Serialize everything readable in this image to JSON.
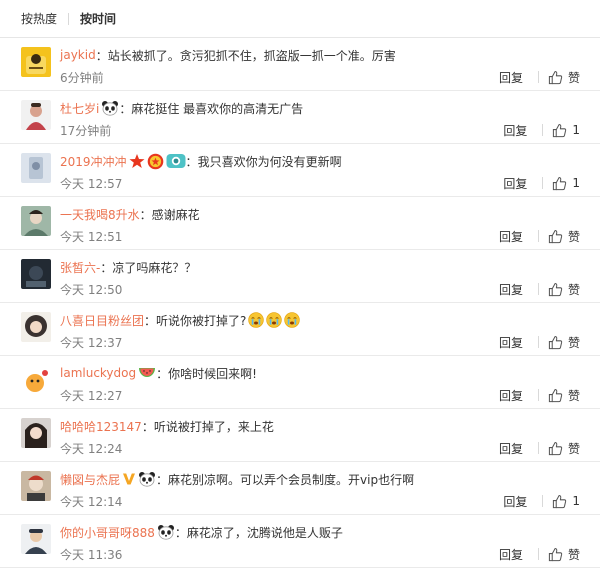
{
  "sort": {
    "hot": "按热度",
    "time": "按时间"
  },
  "reply_label": "回复",
  "colors": {
    "username": "#eb7350",
    "meta": "#808080"
  },
  "comments": [
    {
      "user": "jaykid",
      "badges": [],
      "text": "站长被抓了。贪污犯抓不住，抓盗版一抓一个准。厉害",
      "time": "6分钟前",
      "likes": "赞"
    },
    {
      "user": "杜七岁i",
      "badges": [
        "panda-face-icon"
      ],
      "text": "麻花挺住 最喜欢你的高清无广告",
      "time": "17分钟前",
      "likes": "1"
    },
    {
      "user": "2019冲冲冲",
      "badges": [
        "red-star-icon",
        "medal-icon",
        "camera-badge-icon"
      ],
      "text": "我只喜欢你为何没有更新啊",
      "time": "今天 12:57",
      "likes": "1"
    },
    {
      "user": "一天我喝8升水",
      "badges": [],
      "text": "感谢麻花",
      "time": "今天 12:51",
      "likes": "赞"
    },
    {
      "user": "张皙六-",
      "badges": [],
      "text": "凉了吗麻花？？",
      "time": "今天 12:50",
      "likes": "赞"
    },
    {
      "user": "八喜日目粉丝团",
      "badges": [],
      "text": "听说你被打掉了?",
      "emojis": [
        "crying-face-icon",
        "crying-face-icon",
        "crying-face-icon"
      ],
      "time": "今天 12:37",
      "likes": "赞"
    },
    {
      "user": "lamluckydog",
      "badges": [
        "watermelon-icon"
      ],
      "text": "你啥时候回来啊!",
      "time": "今天 12:27",
      "likes": "赞"
    },
    {
      "user": "哈哈哈123147",
      "badges": [],
      "text": "听说被打掉了，来上花",
      "time": "今天 12:24",
      "likes": "赞"
    },
    {
      "user": "懒図与杰屁",
      "badges": [
        "v-badge-icon",
        "panda-face-icon"
      ],
      "text": "麻花别凉啊。可以弄个会员制度。开vip也行啊",
      "time": "今天 12:14",
      "likes": "1"
    },
    {
      "user": "你的小哥哥呀888",
      "badges": [
        "panda-face-icon"
      ],
      "text": "麻花凉了，沈腾说他是人贩子",
      "time": "今天 11:36",
      "likes": "赞"
    }
  ]
}
